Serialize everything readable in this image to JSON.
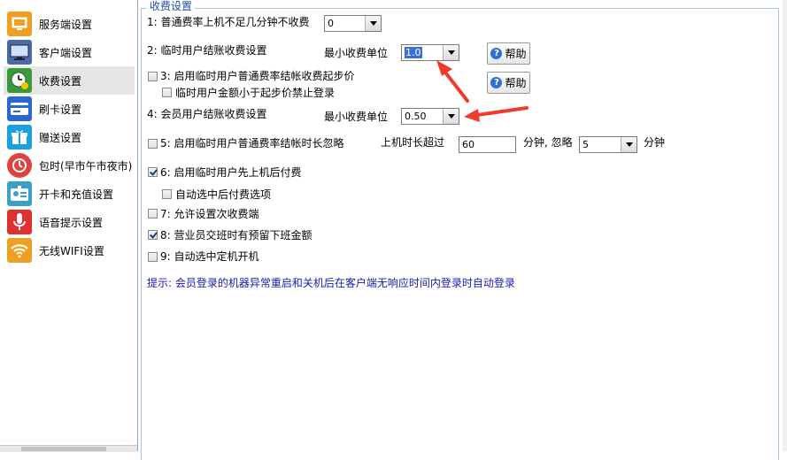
{
  "sidebar": {
    "items": [
      {
        "label": "服务端设置",
        "icon": "server-monitor-icon",
        "color": "#f0a020"
      },
      {
        "label": "客户端设置",
        "icon": "monitor-icon",
        "color": "#4a6aa8"
      },
      {
        "label": "收费设置",
        "icon": "clock-coin-icon",
        "color": "#3a9a3a"
      },
      {
        "label": "刷卡设置",
        "icon": "card-icon",
        "color": "#2a6ad0"
      },
      {
        "label": "赠送设置",
        "icon": "gift-icon",
        "color": "#1aa0e0"
      },
      {
        "label": "包时(早市午市夜市)",
        "icon": "timer-icon",
        "color": "#e04040"
      },
      {
        "label": "开卡和充值设置",
        "icon": "id-card-icon",
        "color": "#3aa0c8"
      },
      {
        "label": "语音提示设置",
        "icon": "microphone-icon",
        "color": "#e03030"
      },
      {
        "label": "无线WIFI设置",
        "icon": "wifi-icon",
        "color": "#f0a020"
      }
    ],
    "selected_index": 2
  },
  "group": {
    "title": "收费设置",
    "row1": {
      "label": "1: 普通费率上机不足几分钟不收费",
      "value": "0"
    },
    "row2": {
      "label": "2: 临时用户结账收费设置",
      "unit_label": "最小收费单位",
      "value": "1.0",
      "help": "帮助"
    },
    "row3": {
      "label": "3: 启用临时用户普通费率结帐收费起步价",
      "checked": false,
      "help": "帮助"
    },
    "row3sub": {
      "label": "临时用户金额小于起步价禁止登录",
      "checked": false
    },
    "row4": {
      "label": "4: 会员用户结账收费设置",
      "unit_label": "最小收费单位",
      "value": "0.50"
    },
    "row5": {
      "label": "5: 启用临时用户普通费率结帐时长忽略",
      "checked": false,
      "pre": "上机时长超过",
      "value1": "60",
      "mid": "分钟, 忽略",
      "value2": "5",
      "post": "分钟"
    },
    "row6": {
      "label": "6: 启用临时用户先上机后付费",
      "checked": true
    },
    "row6sub": {
      "label": "自动选中后付费选项",
      "checked": false
    },
    "row7": {
      "label": "7: 允许设置次收费端",
      "checked": false
    },
    "row8": {
      "label": "8: 营业员交班时有预留下班金额",
      "checked": true
    },
    "row9": {
      "label": "9: 自动选中定机开机",
      "checked": false
    },
    "hint": "提示: 会员登录的机器异常重启和关机后在客户端无响应时间内登录时自动登录"
  },
  "colors": {
    "arrow": "#ee3b2c",
    "accent": "#2f6fd0",
    "hint": "#1a1ab0"
  }
}
